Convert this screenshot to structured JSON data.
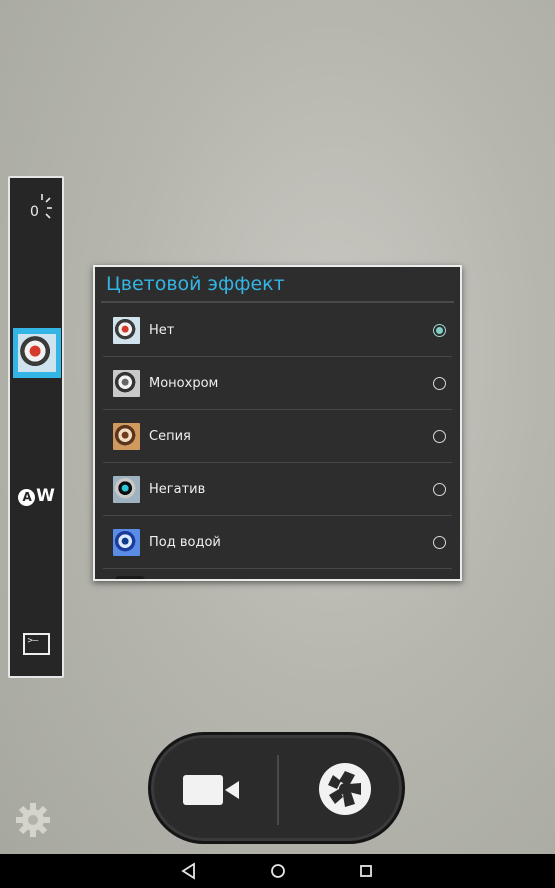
{
  "sidebar": {
    "exposure_value": "0"
  },
  "dialog": {
    "title": "Цветовой эффект",
    "options": [
      {
        "label": "Нет",
        "selected": true,
        "thumb": "effect-none"
      },
      {
        "label": "Монохром",
        "selected": false,
        "thumb": "effect-mono"
      },
      {
        "label": "Сепия",
        "selected": false,
        "thumb": "effect-sepia"
      },
      {
        "label": "Негатив",
        "selected": false,
        "thumb": "effect-negative"
      },
      {
        "label": "Под водой",
        "selected": false,
        "thumb": "effect-aqua"
      }
    ]
  },
  "icons": {
    "sidebar_exposure": "exposure-icon",
    "sidebar_effect": "color-effect-icon",
    "sidebar_wb": "white-balance-auto-icon",
    "sidebar_scene": "scene-mode-icon",
    "video": "video-camera-icon",
    "photo": "shutter-icon",
    "settings": "gear-icon",
    "nav_back": "back-icon",
    "nav_home": "home-icon",
    "nav_recents": "recents-icon"
  },
  "colors": {
    "accent": "#33b5e5",
    "radio_selected": "#7fcfc6"
  }
}
